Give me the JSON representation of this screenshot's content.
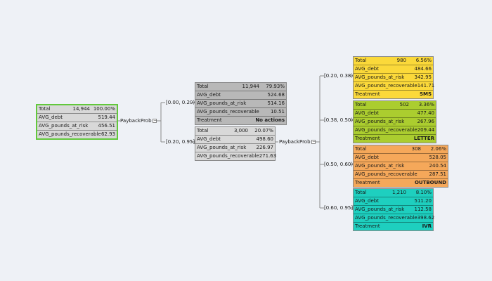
{
  "root": {
    "total_label": "Total",
    "total_count": "14,944",
    "total_pct": "100.00%",
    "metrics": [
      {
        "label": "AVG_debt",
        "value": "519.44"
      },
      {
        "label": "AVG_pounds_at_risk",
        "value": "456.51"
      },
      {
        "label": "AVG_pounds_recoverable",
        "value": "62.93"
      }
    ],
    "color": "#d8d8d8"
  },
  "split1": {
    "label": "PaybackProb",
    "ranges": [
      "[0.00, 0.20)",
      "[0.20, 0.95]"
    ]
  },
  "level1": [
    {
      "total_label": "Total",
      "total_count": "11,944",
      "total_pct": "79.93%",
      "metrics": [
        {
          "label": "AVG_debt",
          "value": "524.68"
        },
        {
          "label": "AVG_pounds_at_risk",
          "value": "514.16"
        },
        {
          "label": "AVG_pounds_recoverable",
          "value": "10.51"
        }
      ],
      "treatment_label": "Treatment",
      "treatment_value": "No actions",
      "color": "#b8b8b8"
    },
    {
      "total_label": "Total",
      "total_count": "3,000",
      "total_pct": "20.07%",
      "metrics": [
        {
          "label": "AVG_debt",
          "value": "498.60"
        },
        {
          "label": "AVG_pounds_at_risk",
          "value": "226.97"
        },
        {
          "label": "AVG_pounds_recoverable",
          "value": "271.63"
        }
      ],
      "color": "#d8d8d8"
    }
  ],
  "split2": {
    "label": "PaybackProb",
    "ranges": [
      "[0.20, 0.38)",
      "[0.38, 0.50)",
      "[0.50, 0.60)",
      "[0.60, 0.95]"
    ]
  },
  "leaves": [
    {
      "total_label": "Total",
      "total_count": "980",
      "total_pct": "6.56%",
      "metrics": [
        {
          "label": "AVG_debt",
          "value": "484.66"
        },
        {
          "label": "AVG_pounds_at_risk",
          "value": "342.95"
        },
        {
          "label": "AVG_pounds_recoverable",
          "value": "141.71"
        }
      ],
      "treatment_label": "Treatment",
      "treatment_value": "SMS",
      "color": "#fbd93a"
    },
    {
      "total_label": "Total",
      "total_count": "502",
      "total_pct": "3.36%",
      "metrics": [
        {
          "label": "AVG_debt",
          "value": "477.40"
        },
        {
          "label": "AVG_pounds_at_risk",
          "value": "267.96"
        },
        {
          "label": "AVG_pounds_recoverable",
          "value": "209.44"
        }
      ],
      "treatment_label": "Treatment",
      "treatment_value": "LETTER",
      "color": "#abcd2f"
    },
    {
      "total_label": "Total",
      "total_count": "308",
      "total_pct": "2.06%",
      "metrics": [
        {
          "label": "AVG_debt",
          "value": "528.05"
        },
        {
          "label": "AVG_pounds_at_risk",
          "value": "240.54"
        },
        {
          "label": "AVG_pounds_recoverable",
          "value": "287.51"
        }
      ],
      "treatment_label": "Treatment",
      "treatment_value": "OUTBOUND",
      "color": "#f5a85a"
    },
    {
      "total_label": "Total",
      "total_count": "1,210",
      "total_pct": "8.10%",
      "metrics": [
        {
          "label": "AVG_debt",
          "value": "511.20"
        },
        {
          "label": "AVG_pounds_at_risk",
          "value": "112.58"
        },
        {
          "label": "AVG_pounds_recoverable",
          "value": "398.62"
        }
      ],
      "treatment_label": "Treatment",
      "treatment_value": "IVR",
      "color": "#1ecfbf"
    }
  ]
}
